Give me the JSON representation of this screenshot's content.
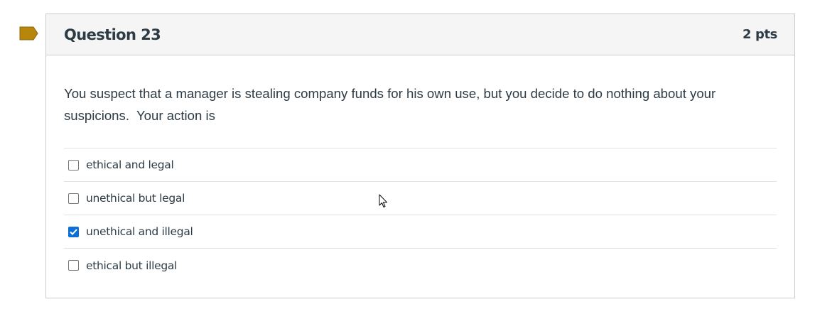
{
  "question": {
    "title": "Question 23",
    "points": "2 pts",
    "text": "You suspect that a manager is stealing company funds for his own use, but you decide to do nothing about your suspicions.  Your action is"
  },
  "answers": [
    {
      "label": "ethical and legal",
      "checked": false
    },
    {
      "label": "unethical but legal",
      "checked": false
    },
    {
      "label": "unethical and illegal",
      "checked": true
    },
    {
      "label": "ethical but illegal",
      "checked": false
    }
  ],
  "colors": {
    "flag": "#b8860b",
    "checkbox_checked": "#0b6fd6",
    "text": "#2d3b45",
    "header_bg": "#f5f5f5"
  },
  "icons": {
    "flag": "bookmark-flag-icon",
    "cursor": "mouse-pointer-icon"
  }
}
